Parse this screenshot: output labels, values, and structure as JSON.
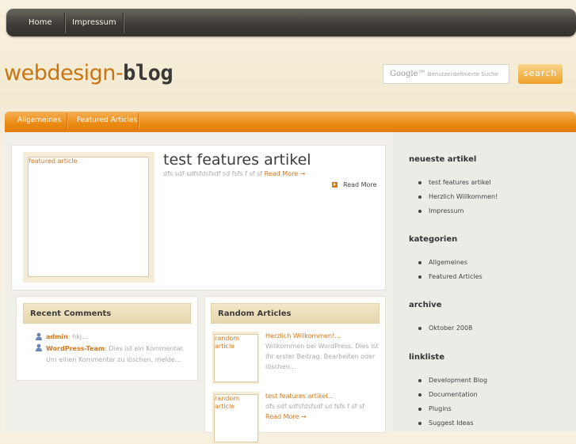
{
  "topnav": {
    "items": [
      "Home",
      "Impressum"
    ]
  },
  "logo": {
    "part1": "webdesign-",
    "part2": "blog"
  },
  "search": {
    "google_label": "Google™",
    "placeholder": "Benutzerdefinierte Suche",
    "button": "search"
  },
  "catnav": {
    "items": [
      "Allgemeines",
      "Featured Articles"
    ]
  },
  "featured": {
    "image_label": "featured article",
    "title": "test features artikel",
    "excerpt": "dfs sdf sdfsfdsfsdf sd fsfs f sf sf",
    "excerpt_link": "Read More →",
    "read_more": "Read More"
  },
  "recent_comments": {
    "title": "Recent Comments",
    "items": [
      {
        "author": "admin",
        "text": ": hkj..."
      },
      {
        "author": "WordPress-Team",
        "text": ": Dies ist ein Kommentar. Um einen Kommentar zu löschen, melde..."
      }
    ]
  },
  "random_articles": {
    "title": "Random Articles",
    "items": [
      {
        "thumb": "random article",
        "title": "Herzlich Willkommen!...",
        "text": "Willkommen bei WordPress. Dies ist Ihr erster Beitrag. Bearbeiten oder löschen..."
      },
      {
        "thumb": "random article",
        "title": "test features artikel...",
        "text": "dfs sdf sdfsfdsfsdf sd fsfs f sf sf",
        "link": "Read More →"
      }
    ]
  },
  "sidebar": {
    "newest_title": "neueste artikel",
    "newest": [
      "test features artikel",
      "Herzlich Willkommen!",
      "Impressum"
    ],
    "categories_title": "kategorien",
    "categories": [
      "Allgemeines",
      "Featured Articles"
    ],
    "archive_title": "archive",
    "archive": [
      "Oktober 2008"
    ],
    "links_title": "linkliste",
    "links": [
      "Development Blog",
      "Documentation",
      "Plugins",
      "Suggest Ideas"
    ]
  },
  "colors": {
    "accent": "#e88a14",
    "nav_dark": "#3f3c37",
    "link": "#d2781c"
  }
}
